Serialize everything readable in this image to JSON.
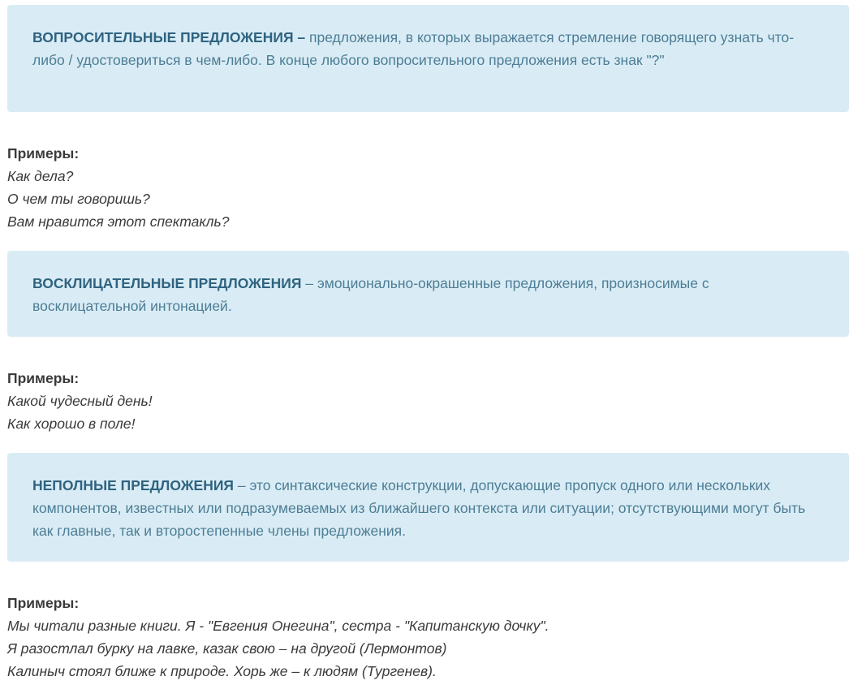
{
  "sections": [
    {
      "term": "ВОПРОСИТЕЛЬНЫЕ ПРЕДЛОЖЕНИЯ –",
      "definition": " предложения, в которых выражается стремление говорящего узнать что-либо / удостовериться в чем-либо. В конце любого вопросительного предложения есть знак \"?\"",
      "examples_title": "Примеры:",
      "examples": [
        "Как дела?",
        "О чем ты говоришь?",
        "Вам нравится этот спектакль?"
      ]
    },
    {
      "term": "ВОСКЛИЦАТЕЛЬНЫЕ ПРЕДЛОЖЕНИЯ",
      "definition": " – эмоционально-окрашенные предложения, произносимые с восклицательной интонацией.",
      "examples_title": "Примеры:",
      "examples": [
        "Какой чудесный день!",
        "Как хорошо в поле!"
      ]
    },
    {
      "term": "НЕПОЛНЫЕ ПРЕДЛОЖЕНИЯ",
      "definition": " – это синтаксические конструкции, допускающие пропуск одного или нескольких компонентов, известных или подразумеваемых из ближайшего контекста или ситуации; отсутствующими могут быть как главные, так и второстепенные члены предложения.",
      "examples_title": "Примеры:",
      "examples": [
        "Мы читали разные книги. Я - \"Евгения Онегина\", сестра - \"Капитанскую дочку\".",
        "Я разостлал бурку на лавке, казак свою – на другой (Лермонтов)",
        "Калиныч стоял ближе к природе. Хорь же – к людям (Тургенев)."
      ]
    }
  ],
  "colors": {
    "box_background": "#d9ecf5",
    "term_color": "#2f6380",
    "definition_color": "#4d7d95",
    "body_text": "#3a3a3a"
  }
}
